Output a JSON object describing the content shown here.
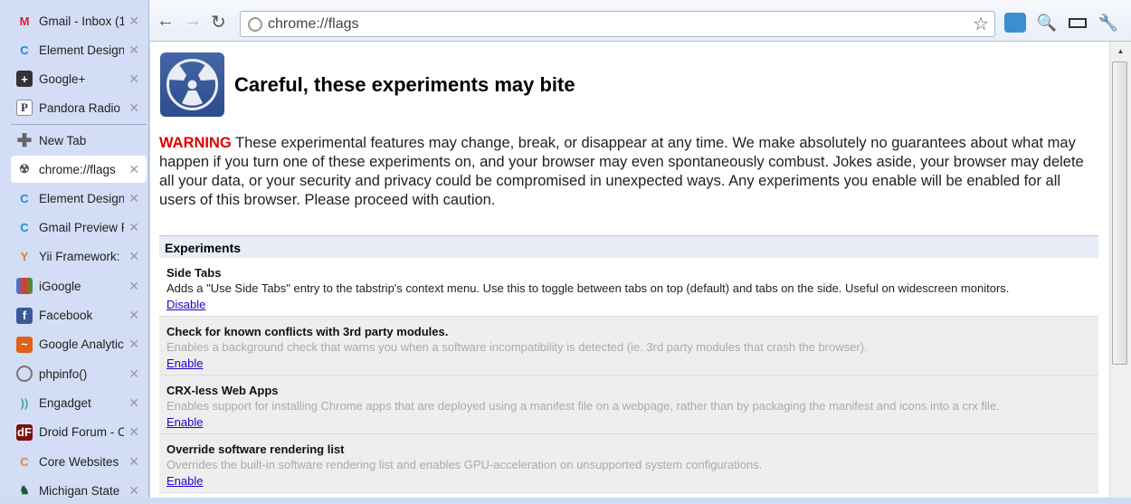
{
  "tabs": [
    {
      "label": "Gmail - Inbox (1",
      "icon": "gmail-icon"
    },
    {
      "label": "Element Design",
      "icon": "element-design-icon"
    },
    {
      "label": "Google+",
      "icon": "google-plus-icon"
    },
    {
      "label": "Pandora Radio -",
      "icon": "pandora-icon"
    }
  ],
  "new_tab": "New Tab",
  "tabs2": [
    {
      "label": "chrome://flags",
      "icon": "radiation-icon",
      "selected": true
    },
    {
      "label": "Element Design",
      "icon": "element-design-icon"
    },
    {
      "label": "Gmail Preview P",
      "icon": "element-design-icon"
    },
    {
      "label": "Yii Framework: E",
      "icon": "yii-icon"
    },
    {
      "label": "iGoogle",
      "icon": "igoogle-icon"
    },
    {
      "label": "Facebook",
      "icon": "facebook-icon"
    },
    {
      "label": "Google Analytic",
      "icon": "analytics-icon"
    },
    {
      "label": "phpinfo()",
      "icon": "globe-icon"
    },
    {
      "label": "Engadget",
      "icon": "engadget-icon"
    },
    {
      "label": "Droid Forum - C",
      "icon": "droid-forum-icon"
    },
    {
      "label": "Core Websites",
      "icon": "core-icon"
    },
    {
      "label": "Michigan State U",
      "icon": "spartan-icon"
    }
  ],
  "close_glyph": "✕",
  "omnibox": {
    "url": "chrome://flags"
  },
  "page": {
    "title": "Careful, these experiments may bite",
    "warning_label": "WARNING",
    "warning_text": " These experimental features may change, break, or disappear at any time. We make absolutely no guarantees about what may happen if you turn one of these experiments on, and your browser may even spontaneously combust. Jokes aside, your browser may delete all your data, or your security and privacy could be compromised in unexpected ways. Any experiments you enable will be enabled for all users of this browser. Please proceed with caution.",
    "experiments_header": "Experiments",
    "experiments": [
      {
        "name": "Side Tabs",
        "desc": "Adds a \"Use Side Tabs\" entry to the tabstrip's context menu. Use this to toggle between tabs on top (default) and tabs on the side. Useful on widescreen monitors.",
        "link": "Disable",
        "enabled": true
      },
      {
        "name": "Check for known conflicts with 3rd party modules.",
        "desc": "Enables a background check that warns you when a software incompatibility is detected (ie. 3rd party modules that crash the browser).",
        "link": "Enable",
        "enabled": false
      },
      {
        "name": "CRX-less Web Apps",
        "desc": "Enables support for installing Chrome apps that are deployed using a manifest file on a webpage, rather than by packaging the manifest and icons into a crx file.",
        "link": "Enable",
        "enabled": false
      },
      {
        "name": "Override software rendering list",
        "desc": "Overrides the built-in software rendering list and enables GPU-acceleration on unsupported system configurations.",
        "link": "Enable",
        "enabled": false
      }
    ]
  }
}
